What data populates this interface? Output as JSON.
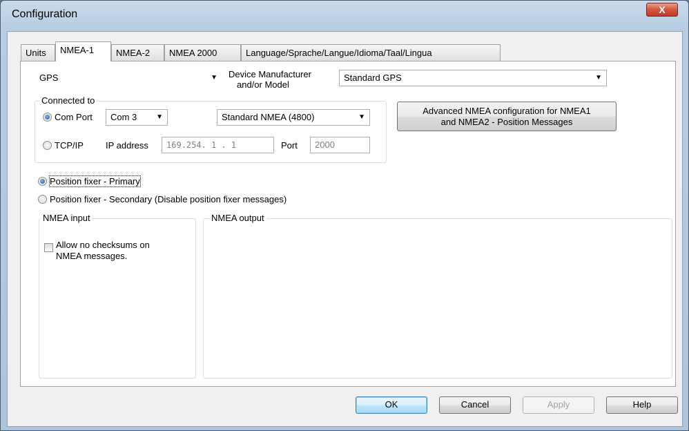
{
  "window": {
    "title": "Configuration",
    "close_label": "X"
  },
  "tabs": [
    {
      "label": "Units"
    },
    {
      "label": "NMEA-1"
    },
    {
      "label": "NMEA-2"
    },
    {
      "label": "NMEA 2000"
    },
    {
      "label": "Language/Sprache/Langue/Idioma/Taal/Lingua"
    }
  ],
  "device": {
    "type_value": "GPS",
    "manufacturer_label_line1": "Device Manufacturer",
    "manufacturer_label_line2": "and/or Model",
    "manufacturer_value": "Standard GPS"
  },
  "connection": {
    "group_title": "Connected to",
    "com_port_label": "Com Port",
    "com_port_value": "Com 3",
    "baud_value": "Standard NMEA (4800)",
    "tcpip_label": "TCP/IP",
    "ip_label": "IP address",
    "ip_value": "169.254. 1 . 1",
    "port_label": "Port",
    "port_value": "2000"
  },
  "advanced_button": {
    "line1": "Advanced NMEA configuration for NMEA1",
    "line2": "and NMEA2 - Position Messages"
  },
  "position_fixer": {
    "primary_label": "Position fixer - Primary",
    "secondary_label": "Position fixer - Secondary (Disable position fixer messages)"
  },
  "nmea_input": {
    "title": "NMEA input",
    "checksum_line1": "Allow no checksums on",
    "checksum_line2": "NMEA messages."
  },
  "nmea_output": {
    "title": "NMEA output"
  },
  "footer": {
    "ok": "OK",
    "cancel": "Cancel",
    "apply": "Apply",
    "help": "Help"
  }
}
